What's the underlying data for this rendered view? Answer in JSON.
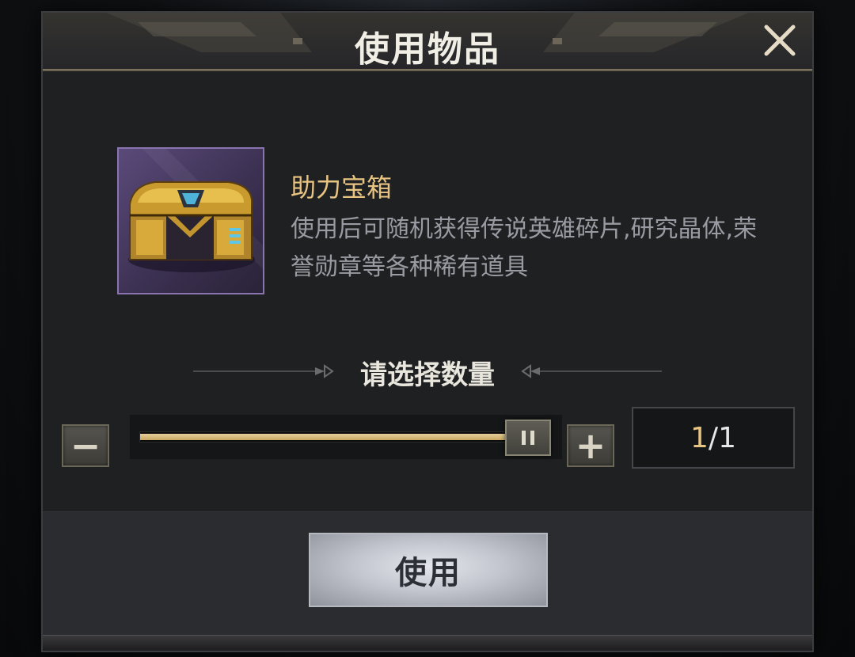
{
  "dialog": {
    "title": "使用物品"
  },
  "item": {
    "name": "助力宝箱",
    "description": "使用后可随机获得传说英雄碎片,研究晶体,荣誉勋章等各种稀有道具"
  },
  "quantity": {
    "label": "请选择数量",
    "current": "1",
    "separator": "/",
    "max": "1",
    "slider_fraction": 1.0,
    "minus_symbol": "−",
    "plus_symbol": "+"
  },
  "actions": {
    "use_label": "使用"
  },
  "colors": {
    "accent_gold": "#e8c483",
    "panel_bg": "#1f2022",
    "item_frame_purple": "#8a74b0"
  },
  "icons": {
    "close": "close-icon",
    "chest": "treasure-chest-icon",
    "thumb": "slider-grip-icon"
  }
}
